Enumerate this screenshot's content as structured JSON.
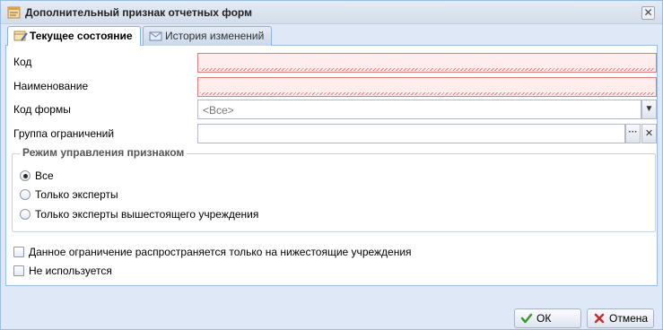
{
  "window": {
    "title": "Дополнительный признак отчетных форм",
    "close_glyph": "✕"
  },
  "tabs": [
    {
      "label": "Текущее состояние",
      "icon": "table-pencil-icon",
      "active": true
    },
    {
      "label": "История изменений",
      "icon": "history-mail-icon",
      "active": false
    }
  ],
  "form": {
    "code_label": "Код",
    "code_value": "",
    "name_label": "Наименование",
    "name_value": "",
    "form_code_label": "Код формы",
    "form_code_value": "<Все>",
    "group_label": "Группа ограничений",
    "group_value": "",
    "group_browse_glyph": "···",
    "group_clear_glyph": "✕",
    "combo_arrow_glyph": "▼"
  },
  "mode_group": {
    "legend": "Режим управления признаком",
    "options": [
      {
        "label": "Все",
        "checked": true
      },
      {
        "label": "Только эксперты",
        "checked": false
      },
      {
        "label": "Только эксперты вышестоящего учреждения",
        "checked": false
      }
    ]
  },
  "checks": [
    {
      "label": "Данное ограничение распространяется только на нижестоящие учреждения",
      "checked": false
    },
    {
      "label": "Не используется",
      "checked": false
    }
  ],
  "buttons": {
    "ok_label": "ОК",
    "cancel_label": "Отмена"
  },
  "colors": {
    "invalid_field_bg": "#ffecec",
    "invalid_field_border": "#e07a7a",
    "ok_icon": "#3a9a2e",
    "cancel_icon": "#c0302a"
  }
}
